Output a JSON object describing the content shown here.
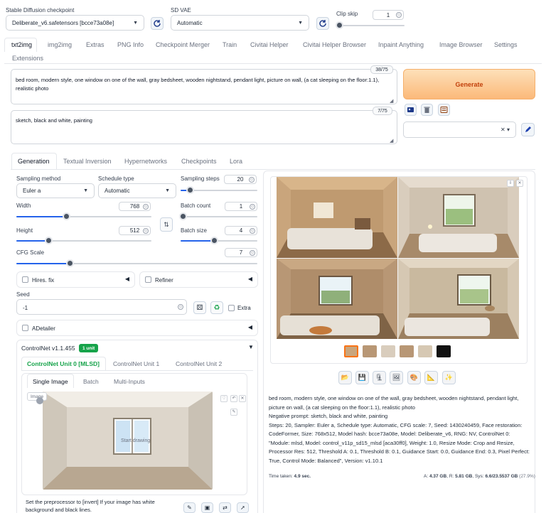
{
  "top": {
    "checkpoint_label": "Stable Diffusion checkpoint",
    "checkpoint_value": "Deliberate_v6.safetensors [bcce73a08e]",
    "vae_label": "SD VAE",
    "vae_value": "Automatic",
    "clip_label": "Clip skip",
    "clip_value": "1",
    "clip_level": 0
  },
  "main_tabs": [
    "txt2img",
    "img2img",
    "Extras",
    "PNG Info",
    "Checkpoint Merger",
    "Train",
    "Civitai Helper",
    "Civitai Helper Browser",
    "Inpaint Anything",
    "Image Browser",
    "Settings",
    "Extensions"
  ],
  "prompt": {
    "text": "bed room, modern style, one window on one of the wall, gray bedsheet, wooden nightstand, pendant light, picture on wall, (a cat sleeping on the floor:1.1), realistic photo",
    "counter": "38/75"
  },
  "negative": {
    "text": "sketch, black and white, painting",
    "counter": "7/75"
  },
  "generate_label": "Generate",
  "sub_tabs": [
    "Generation",
    "Textual Inversion",
    "Hypernetworks",
    "Checkpoints",
    "Lora"
  ],
  "gen": {
    "sampling_method_label": "Sampling method",
    "sampling_method_value": "Euler a",
    "schedule_type_label": "Schedule type",
    "schedule_type_value": "Automatic",
    "steps_label": "Sampling steps",
    "steps_value": "20",
    "width_label": "Width",
    "width_value": "768",
    "height_label": "Height",
    "height_value": "512",
    "batch_count_label": "Batch count",
    "batch_count_value": "1",
    "batch_size_label": "Batch size",
    "batch_size_value": "4",
    "cfg_label": "CFG Scale",
    "cfg_value": "7",
    "hires_label": "Hires. fix",
    "refiner_label": "Refiner",
    "seed_label": "Seed",
    "seed_value": "-1",
    "extra_label": "Extra",
    "adetailer_label": "ADetailer"
  },
  "controlnet": {
    "title": "ControlNet v1.1.455",
    "badge": "1 unit",
    "unit_tabs": [
      "ControlNet Unit 0 [MLSD]",
      "ControlNet Unit 1",
      "ControlNet Unit 2"
    ],
    "img_tabs": [
      "Single Image",
      "Batch",
      "Multi-Inputs"
    ],
    "image_label": "Image",
    "canvas_overlay": "Start drawing",
    "hint": "Set the preprocessor to [invert] If your image has white background and black lines."
  },
  "output": {
    "info_prompt": "bed room, modern style, one window on one of the wall, gray bedsheet, wooden nightstand, pendant light, picture on wall, (a cat sleeping on the floor:1.1), realistic photo",
    "info_negative": "Negative prompt: sketch, black and white, painting",
    "info_params": "Steps: 20, Sampler: Euler a, Schedule type: Automatic, CFG scale: 7, Seed: 1430240459, Face restoration: CodeFormer, Size: 768x512, Model hash: bcce73a08e, Model: Deliberate_v6, RNG: NV, ControlNet 0: \"Module: mlsd, Model: control_v11p_sd15_mlsd [aca30ff0], Weight: 1.0, Resize Mode: Crop and Resize, Processor Res: 512, Threshold A: 0.1, Threshold B: 0.1, Guidance Start: 0.0, Guidance End: 0.3, Pixel Perfect: True, Control Mode: Balanced\", Version: v1.10.1",
    "time_label": "Time taken:",
    "time_value": "4.9 sec.",
    "vram_a_label": "A:",
    "vram_a": "4.37 GB",
    "vram_r_label": "R:",
    "vram_r": "5.81 GB",
    "vram_sys_label": "Sys:",
    "vram_sys": "6.6/23.5537 GB",
    "vram_pct": "(27.9%)"
  },
  "colors": {
    "accent": "#2563eb",
    "generate_from": "#fcd7a7",
    "generate_to": "#fbb97a",
    "generate_text": "#c2410c",
    "badge": "#16a34a",
    "tab_active": "#16a34a"
  },
  "icons": [
    "refresh-icon",
    "paint-icon",
    "trash-icon",
    "styles-icon",
    "pencil-icon",
    "swap-icon",
    "dice-icon",
    "recycle-icon",
    "folder-icon",
    "save-icon",
    "zip-icon",
    "image-icon",
    "palette-icon",
    "ruler-icon",
    "sparkle-icon"
  ]
}
